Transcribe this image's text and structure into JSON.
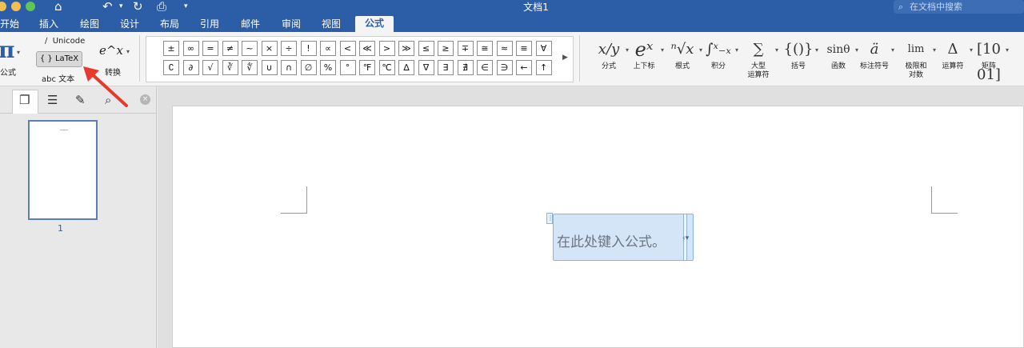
{
  "window": {
    "title": "文档1",
    "search_placeholder": "在文档中搜索"
  },
  "quick_access": {
    "home": "⌂",
    "undo": "↶",
    "redo": "↻",
    "print": "⎙",
    "dropdown": "▾"
  },
  "tabs": [
    "开始",
    "插入",
    "绘图",
    "设计",
    "布局",
    "引用",
    "邮件",
    "审阅",
    "视图",
    "公式"
  ],
  "active_tab": "公式",
  "ribbon": {
    "equation_label": "公式",
    "unicode_label": "Unicode",
    "latex_label": "LaTeX",
    "text_label": "abc 文本",
    "convert_label": "转换",
    "convert_glyph": "e^x",
    "symbols_row1": [
      "±",
      "∞",
      "=",
      "≠",
      "~",
      "×",
      "÷",
      "!",
      "∝",
      "<",
      "≪",
      ">",
      "≫",
      "≤",
      "≥",
      "∓",
      "≅",
      "≈",
      "≡",
      "∀"
    ],
    "symbols_row2": [
      "∁",
      "∂",
      "√",
      "∛",
      "∜",
      "∪",
      "∩",
      "∅",
      "%",
      "°",
      "℉",
      "℃",
      "∆",
      "∇",
      "∃",
      "∄",
      "∈",
      "∋",
      "←",
      "↑"
    ],
    "structures": [
      {
        "glyph": "x/y",
        "label": "分式"
      },
      {
        "glyph": "eˣ",
        "label": "上下标"
      },
      {
        "glyph": "ⁿ√x",
        "label": "根式"
      },
      {
        "glyph": "∫ˣ₋ₓ",
        "label": "积分"
      },
      {
        "glyph": "∑",
        "label": "大型\n运算符"
      },
      {
        "glyph": "{()}",
        "label": "括号"
      },
      {
        "glyph": "sinθ",
        "label": "函数"
      },
      {
        "glyph": "ä",
        "label": "标注符号"
      },
      {
        "glyph": "lim",
        "label": "极限和\n对数"
      },
      {
        "glyph": "Δ",
        "label": "运算符"
      },
      {
        "glyph": "[10 01]",
        "label": "矩阵"
      }
    ]
  },
  "nav_pane": {
    "page_number": "1",
    "close": "×"
  },
  "document": {
    "equation_placeholder": "在此处键入公式。"
  },
  "colors": {
    "title_bar": "#2c5ea8",
    "annotation_arrow": "#e63a2a",
    "equation_box": "#d4e5f7"
  }
}
